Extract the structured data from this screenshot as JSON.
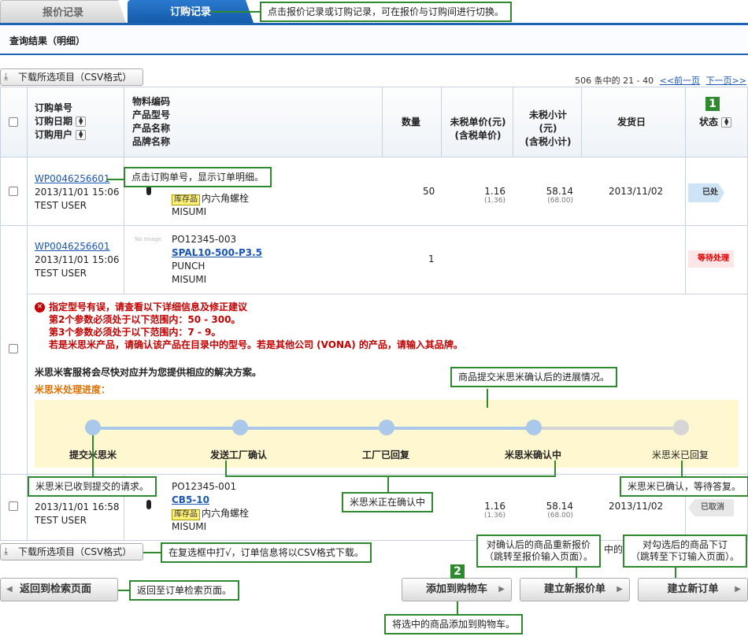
{
  "tabs": {
    "quote": "报价记录",
    "order": "订购记录"
  },
  "section_title": "查询结果（明细）",
  "download_label": "下载所选项目（CSV格式）",
  "paging": {
    "info": "506 条中的 21 - 40",
    "prev": "<<前一页",
    "next": "下一页>>"
  },
  "headers": {
    "order_no": "订购单号",
    "order_date": "订购日期",
    "order_user": "订购用户",
    "material_code": "物料编码",
    "product_model": "产品型号",
    "product_name": "产品名称",
    "brand_name": "品牌名称",
    "qty": "数量",
    "unit_price": "未税单价(元)",
    "unit_price_tax": "(含税单价)",
    "subtotal": "未税小计",
    "subtotal_unit": "(元)",
    "subtotal_tax": "(含税小计)",
    "ship_date": "发货日",
    "status": "状态"
  },
  "rows": [
    {
      "order_no": "WP0046256601",
      "date": "2013/11/01 15:06",
      "user": "TEST USER",
      "stock": "库存品",
      "name": "内六角螺栓",
      "brand": "MISUMI",
      "qty": "50",
      "price": "1.16",
      "price_tax": "(1.36)",
      "subtotal": "58.14",
      "subtotal_tax": "(68.00)",
      "ship": "2013/11/02",
      "status": "已处理"
    },
    {
      "order_no": "WP0046256601",
      "date": "2013/11/01 15:06",
      "user": "TEST USER",
      "code": "PO12345-003",
      "model": "SPAL10-500-P3.5",
      "name": "PUNCH",
      "brand": "MISUMI",
      "qty": "1",
      "status": "等待处理",
      "no_image": "No Image"
    },
    {
      "date": "2013/11/01 16:58",
      "user": "TEST USER",
      "code": "PO12345-001",
      "model": "CB5-10",
      "stock": "库存品",
      "name": "内六角螺栓",
      "brand": "MISUMI",
      "price": "1.16",
      "price_tax": "(1.36)",
      "subtotal": "58.14",
      "subtotal_tax": "(68.00)",
      "ship": "2013/11/02",
      "status": "已取消"
    }
  ],
  "error": {
    "icon": "error-x-icon",
    "line1": "指定型号有误，请查看以下详细信息及修正建议",
    "line2": "第2个参数必须处于以下范围内：50 - 300。",
    "line3": "第3个参数必须处于以下范围内：7 - 9。",
    "line4": "若是米思米产品，请确认该产品在目录中的型号。若是其他公司 (VONA) 的产品，请输入其品牌。"
  },
  "support_msg": "米思米客服将会尽快对应并为您提供相应的解决方案。",
  "progress_title": "米思米处理进度：",
  "progress_steps": [
    "提交米思米",
    "发送工厂确认",
    "工厂已回复",
    "米思米确认中",
    "米思米已回复"
  ],
  "progress_level": 0.75,
  "buttons": {
    "back": "返回到检索页面",
    "cart": "添加到购物车",
    "requote": "建立新报价单",
    "order": "建立新订单"
  },
  "partial_text": "中的",
  "callouts": {
    "tabs": "点击报价记录或订购记录，可在报价与订购间进行切换。",
    "order_no": "点击订购单号，显示订单明细。",
    "progress": "商品提交米思米确认后的进展情况。",
    "received": "米思米已收到提交的请求。",
    "confirming": "米思米正在确认中",
    "confirmed": "米思米已确认，等待答复。",
    "csv": "在复选框中打√，订单信息将以CSV格式下载。",
    "requote_line1": "对确认后的商品重新报价",
    "requote_line2": "（跳转至报价输入页面）。",
    "order_line1": "对勾选后的商品下订",
    "order_line2": "（跳转至下订输入页面）。",
    "back": "返回至订单检索页面。",
    "cart": "将选中的商品添加到购物车。"
  },
  "markers": {
    "m1": "1",
    "m2": "2"
  },
  "colors": {
    "accent": "#1e64b6",
    "callout": "#2f8a2f",
    "error": "#c40000",
    "progress_done": "#a9c8ea",
    "progress_todo": "#d6d6d6"
  }
}
